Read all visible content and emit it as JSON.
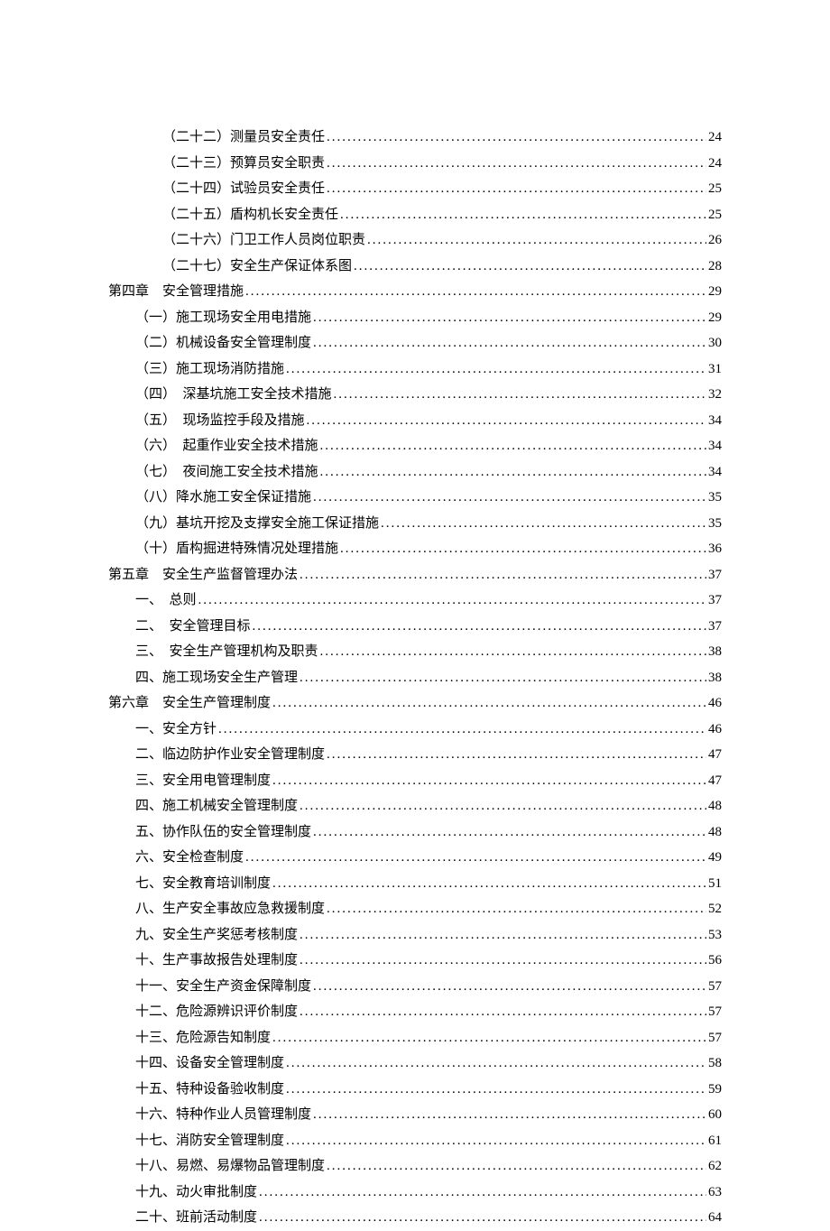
{
  "toc": [
    {
      "indent": 2,
      "label": "（二十二）测量员安全责任",
      "page": "24"
    },
    {
      "indent": 2,
      "label": "（二十三）预算员安全职责",
      "page": "24"
    },
    {
      "indent": 2,
      "label": "（二十四）试验员安全责任",
      "page": "25"
    },
    {
      "indent": 2,
      "label": "（二十五）盾构机长安全责任",
      "page": "25"
    },
    {
      "indent": 2,
      "label": "（二十六）门卫工作人员岗位职责",
      "page": "26"
    },
    {
      "indent": 2,
      "label": "（二十七）安全生产保证体系图",
      "page": "28"
    },
    {
      "indent": 0,
      "label": "第四章　安全管理措施",
      "page": "29"
    },
    {
      "indent": 1,
      "label": "（一）施工现场安全用电措施",
      "page": "29"
    },
    {
      "indent": 1,
      "label": "（二）机械设备安全管理制度",
      "page": "30"
    },
    {
      "indent": 1,
      "label": "（三）施工现场消防措施",
      "page": "31"
    },
    {
      "indent": 1,
      "label": "（四）　深基坑施工安全技术措施",
      "page": "32"
    },
    {
      "indent": 1,
      "label": "（五）　现场监控手段及措施",
      "page": "34"
    },
    {
      "indent": 1,
      "label": "（六）　起重作业安全技术措施",
      "page": "34"
    },
    {
      "indent": 1,
      "label": "（七）　夜间施工安全技术措施",
      "page": "34"
    },
    {
      "indent": 1,
      "label": "（八）降水施工安全保证措施",
      "page": "35"
    },
    {
      "indent": 1,
      "label": "（九）基坑开挖及支撑安全施工保证措施",
      "page": "35"
    },
    {
      "indent": 1,
      "label": "（十）盾构掘进特殊情况处理措施",
      "page": "36"
    },
    {
      "indent": 0,
      "label": "第五章　安全生产监督管理办法",
      "page": "37"
    },
    {
      "indent": 1,
      "label": "一、　总则",
      "page": "37"
    },
    {
      "indent": 1,
      "label": "二、　安全管理目标",
      "page": "37"
    },
    {
      "indent": 1,
      "label": "三、　安全生产管理机构及职责",
      "page": "38"
    },
    {
      "indent": 1,
      "label": "四、施工现场安全生产管理",
      "page": "38"
    },
    {
      "indent": 0,
      "label": "第六章　安全生产管理制度",
      "page": "46"
    },
    {
      "indent": 1,
      "label": "一、安全方针",
      "page": "46"
    },
    {
      "indent": 1,
      "label": "二、临边防护作业安全管理制度",
      "page": "47"
    },
    {
      "indent": 1,
      "label": "三、安全用电管理制度",
      "page": "47"
    },
    {
      "indent": 1,
      "label": "四、施工机械安全管理制度",
      "page": "48"
    },
    {
      "indent": 1,
      "label": "五、协作队伍的安全管理制度",
      "page": "48"
    },
    {
      "indent": 1,
      "label": "六、安全检查制度",
      "page": "49"
    },
    {
      "indent": 1,
      "label": "七、安全教育培训制度",
      "page": "51"
    },
    {
      "indent": 1,
      "label": "八、生产安全事故应急救援制度",
      "page": "52"
    },
    {
      "indent": 1,
      "label": "九、安全生产奖惩考核制度",
      "page": "53"
    },
    {
      "indent": 1,
      "label": "十、生产事故报告处理制度",
      "page": "56"
    },
    {
      "indent": 1,
      "label": "十一、安全生产资金保障制度",
      "page": "57"
    },
    {
      "indent": 1,
      "label": "十二、危险源辨识评价制度",
      "page": "57"
    },
    {
      "indent": 1,
      "label": "十三、危险源告知制度",
      "page": "57"
    },
    {
      "indent": 1,
      "label": "十四、设备安全管理制度",
      "page": "58"
    },
    {
      "indent": 1,
      "label": "十五、特种设备验收制度",
      "page": "59"
    },
    {
      "indent": 1,
      "label": "十六、特种作业人员管理制度",
      "page": "60"
    },
    {
      "indent": 1,
      "label": "十七、消防安全管理制度",
      "page": "61"
    },
    {
      "indent": 1,
      "label": "十八、易燃、易爆物品管理制度",
      "page": "62"
    },
    {
      "indent": 1,
      "label": "十九、动火审批制度",
      "page": "63"
    },
    {
      "indent": 1,
      "label": "二十、班前活动制度",
      "page": "64"
    }
  ]
}
